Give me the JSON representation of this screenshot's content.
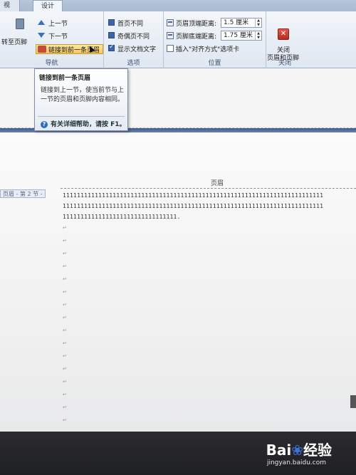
{
  "tabs": {
    "view": "视图",
    "design": "设计"
  },
  "ribbon": {
    "nav": {
      "goto_footer": "转至页脚",
      "prev_section": "上一节",
      "next_section": "下一节",
      "link_to_previous": "链接到前一条页眉",
      "group_label": "导航"
    },
    "options": {
      "different_first": "首页不同",
      "different_odd_even": "奇偶页不同",
      "show_doc_text": "显示文档文字",
      "group_label": "选项"
    },
    "position": {
      "header_from_top_label": "页眉顶端距离:",
      "header_from_top_value": "1.5 厘米",
      "footer_from_bottom_label": "页脚底端距离:",
      "footer_from_bottom_value": "1.75 厘米",
      "insert_align_tab": "插入\"对齐方式\"选项卡",
      "group_label": "位置"
    },
    "close": {
      "label_line1": "关闭",
      "label_line2": "页眉和页脚",
      "group_label": "关闭"
    }
  },
  "tooltip": {
    "title": "链接到前一条页眉",
    "body": "链接到上一节，使当前节与上一节的页眉和页脚内容相同。",
    "help": "有关详细帮助，请按 F1。"
  },
  "document": {
    "header_label": "页眉",
    "section_tag": "页眉 - 第 2 节 -",
    "lines": [
      "1111111111111111111111111111111111111111111111111111111111111111111111111",
      "1111111111111111111111111111111111111111111111111111111111111111111111111",
      "11111111111111111111111111111111."
    ]
  },
  "watermark": {
    "brand": "Bai",
    "brand_end": "经验",
    "site": "jingyan.baidu.com"
  }
}
